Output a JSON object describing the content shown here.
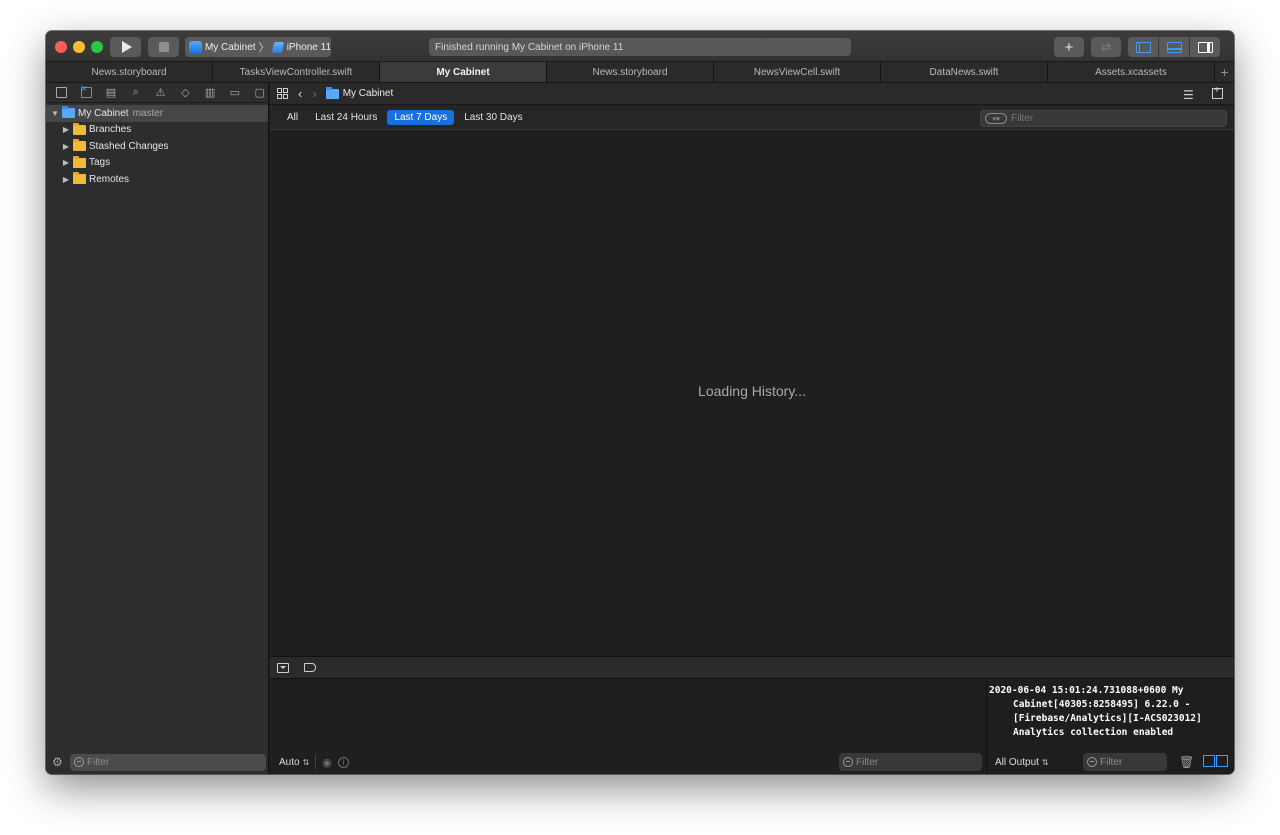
{
  "toolbar": {
    "scheme_app": "My Cabinet",
    "scheme_device": "iPhone 11",
    "activity_status": "Finished running My Cabinet on iPhone 11",
    "add_label": "+",
    "review_label": "⇄"
  },
  "tabs": [
    {
      "label": "News.storyboard",
      "active": false
    },
    {
      "label": "TasksViewController.swift",
      "active": false
    },
    {
      "label": "My Cabinet",
      "active": true
    },
    {
      "label": "News.storyboard",
      "active": false
    },
    {
      "label": "NewsViewCell.swift",
      "active": false
    },
    {
      "label": "DataNews.swift",
      "active": false
    },
    {
      "label": "Assets.xcassets",
      "active": false
    }
  ],
  "tab_add_label": "+",
  "navigator": {
    "root": {
      "label": "My Cabinet",
      "branch": "master"
    },
    "items": [
      {
        "label": "Branches"
      },
      {
        "label": "Stashed Changes"
      },
      {
        "label": "Tags"
      },
      {
        "label": "Remotes"
      }
    ],
    "filter_placeholder": "Filter"
  },
  "editor": {
    "breadcrumb": "My Cabinet",
    "scopes": [
      {
        "label": "All",
        "selected": false
      },
      {
        "label": "Last 24 Hours",
        "selected": false
      },
      {
        "label": "Last 7 Days",
        "selected": true
      },
      {
        "label": "Last 30 Days",
        "selected": false
      }
    ],
    "filter_placeholder": "Filter",
    "loading_text": "Loading History..."
  },
  "debug": {
    "auto_label": "Auto",
    "variables_filter_placeholder": "Filter",
    "console_text": "2020-06-04 15:01:24.731088+0600 My Cabinet[40305:8258495] 6.22.0 - [Firebase/Analytics][I-ACS023012] Analytics collection enabled",
    "output_label": "All Output",
    "console_filter_placeholder": "Filter"
  },
  "colors": {
    "accent": "#1a6fe0",
    "close": "#ff5f57",
    "minimize": "#febc2e",
    "zoom": "#28c840",
    "folder": "#f0b93a"
  }
}
